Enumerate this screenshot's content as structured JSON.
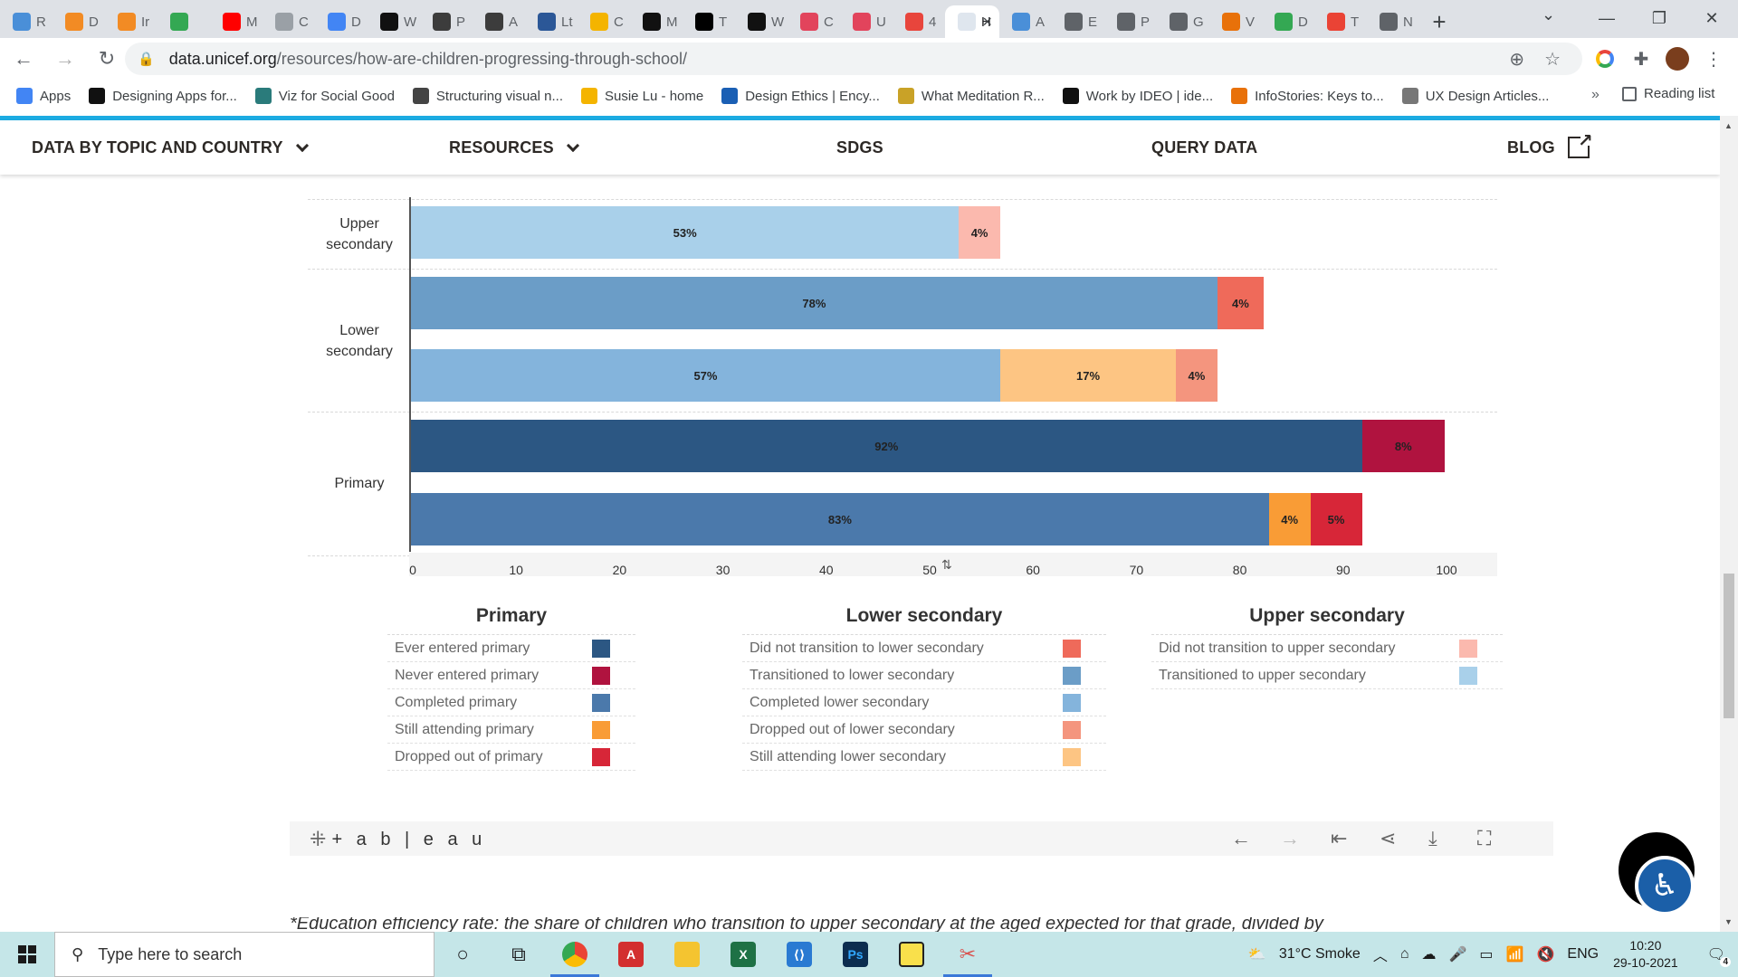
{
  "browser": {
    "tabs": [
      {
        "label": "R",
        "color": "#4a8fd8"
      },
      {
        "label": "D",
        "color": "#f28b24"
      },
      {
        "label": "Ir",
        "color": "#f28b24"
      },
      {
        "label": "",
        "color": "#34a853"
      },
      {
        "label": "M",
        "color": "#ff0000"
      },
      {
        "label": "C",
        "color": "#9aa0a6"
      },
      {
        "label": "D",
        "color": "#4285f4"
      },
      {
        "label": "W",
        "color": "#111111"
      },
      {
        "label": "P",
        "color": "#3c3c3c"
      },
      {
        "label": "A",
        "color": "#3c3c3c"
      },
      {
        "label": "Lt",
        "color": "#2b5797"
      },
      {
        "label": "C",
        "color": "#f4b400"
      },
      {
        "label": "M",
        "color": "#111111"
      },
      {
        "label": "T",
        "color": "#000000"
      },
      {
        "label": "W",
        "color": "#111111"
      },
      {
        "label": "C",
        "color": "#e2445c"
      },
      {
        "label": "U",
        "color": "#e2445c"
      },
      {
        "label": "4",
        "color": "#e8453c"
      }
    ],
    "active_tab": {
      "label": "H",
      "color": "#ffffff"
    },
    "tabs_after": [
      {
        "label": "A",
        "color": "#4a8fd8"
      },
      {
        "label": "E",
        "color": "#5f6368"
      },
      {
        "label": "P",
        "color": "#5f6368"
      },
      {
        "label": "G",
        "color": "#5f6368"
      },
      {
        "label": "V",
        "color": "#e8710a"
      },
      {
        "label": "D",
        "color": "#34a853"
      },
      {
        "label": "T",
        "color": "#ea4335"
      },
      {
        "label": "N",
        "color": "#5f6368"
      }
    ],
    "url_host": "data.unicef.org",
    "url_path": "/resources/how-are-children-progressing-through-school/",
    "bookmarks": [
      {
        "label": "Apps",
        "color": "#4285f4"
      },
      {
        "label": "Designing Apps for...",
        "color": "#111111"
      },
      {
        "label": "Viz for Social Good",
        "color": "#2a7b7b"
      },
      {
        "label": "Structuring visual n...",
        "color": "#444444"
      },
      {
        "label": "Susie Lu - home",
        "color": "#f4b400"
      },
      {
        "label": "Design Ethics | Ency...",
        "color": "#1a5fb4"
      },
      {
        "label": "What Meditation R...",
        "color": "#c9a227"
      },
      {
        "label": "Work by IDEO | ide...",
        "color": "#111111"
      },
      {
        "label": "InfoStories: Keys to...",
        "color": "#e8710a"
      },
      {
        "label": "UX Design Articles...",
        "color": "#777777"
      }
    ],
    "more": "»",
    "reading_list": "Reading list"
  },
  "site_nav": {
    "items": [
      {
        "label": "DATA BY TOPIC AND COUNTRY"
      },
      {
        "label": "RESOURCES"
      },
      {
        "label": "SDGS"
      },
      {
        "label": "QUERY DATA"
      },
      {
        "label": "BLOG"
      }
    ]
  },
  "chart_data": {
    "type": "bar",
    "orientation": "horizontal",
    "stacked": true,
    "row_labels": [
      "Upper secondary",
      "Lower secondary",
      "Primary"
    ],
    "bars": [
      {
        "group": "Upper secondary",
        "segments": [
          {
            "series": "Transitioned to upper secondary",
            "value": 53,
            "label": "53%",
            "color": "#a9d0ea"
          },
          {
            "series": "Did not transition to upper secondary",
            "value": 4,
            "label": "4%",
            "color": "#fbb9ae"
          }
        ]
      },
      {
        "group": "Lower secondary",
        "segments": [
          {
            "series": "Transitioned to lower secondary",
            "value": 78,
            "label": "78%",
            "color": "#6b9dc7"
          },
          {
            "series": "Did not transition to lower secondary",
            "value": 4.5,
            "label": "4%",
            "color": "#ef6a5a"
          }
        ]
      },
      {
        "group": "Lower secondary",
        "segments": [
          {
            "series": "Completed lower secondary",
            "value": 57,
            "label": "57%",
            "color": "#84b4dc"
          },
          {
            "series": "Still attending lower secondary",
            "value": 17,
            "label": "17%",
            "color": "#fdc583"
          },
          {
            "series": "Dropped out of lower secondary",
            "value": 4,
            "label": "4%",
            "color": "#f4957e"
          }
        ]
      },
      {
        "group": "Primary",
        "segments": [
          {
            "series": "Ever entered primary",
            "value": 92,
            "label": "92%",
            "color": "#2c5783"
          },
          {
            "series": "Never entered primary",
            "value": 8,
            "label": "8%",
            "color": "#b0133f"
          }
        ]
      },
      {
        "group": "Primary",
        "segments": [
          {
            "series": "Completed primary",
            "value": 83,
            "label": "83%",
            "color": "#4b79ab"
          },
          {
            "series": "Still attending primary",
            "value": 4,
            "label": "4%",
            "color": "#f99c36"
          },
          {
            "series": "Dropped out of primary",
            "value": 5,
            "label": "5%",
            "color": "#d72638"
          }
        ]
      }
    ],
    "x_ticks": [
      0,
      10,
      20,
      30,
      40,
      50,
      60,
      70,
      80,
      90,
      100
    ],
    "xlim": [
      0,
      100
    ],
    "grid": true
  },
  "legend": {
    "groups": [
      {
        "title": "Primary",
        "items": [
          {
            "label": "Ever entered primary",
            "color": "#2c5783"
          },
          {
            "label": "Never entered primary",
            "color": "#b0133f"
          },
          {
            "label": "Completed primary",
            "color": "#4b79ab"
          },
          {
            "label": "Still attending primary",
            "color": "#f99c36"
          },
          {
            "label": "Dropped out of primary",
            "color": "#d72638"
          }
        ]
      },
      {
        "title": "Lower secondary",
        "items": [
          {
            "label": "Did not transition to lower secondary",
            "color": "#ef6a5a"
          },
          {
            "label": "Transitioned to lower secondary",
            "color": "#6b9dc7"
          },
          {
            "label": "Completed lower secondary",
            "color": "#84b4dc"
          },
          {
            "label": "Dropped out of lower secondary",
            "color": "#f4957e"
          },
          {
            "label": "Still attending lower secondary",
            "color": "#fdc583"
          }
        ]
      },
      {
        "title": "Upper secondary",
        "items": [
          {
            "label": "Did not transition to upper secondary",
            "color": "#fbb9ae"
          },
          {
            "label": "Transitioned to upper secondary",
            "color": "#a9d0ea"
          }
        ]
      }
    ]
  },
  "tableau": {
    "logo": "+ a b | e a u"
  },
  "footnote": "*Education efficiency rate: the share of children who transition to upper secondary at the aged expected for that grade, divided by",
  "taskbar": {
    "search_placeholder": "Type here to search",
    "weather": "31°C  Smoke",
    "lang": "ENG",
    "time": "10:20",
    "date": "29-10-2021",
    "notifications": "4"
  }
}
